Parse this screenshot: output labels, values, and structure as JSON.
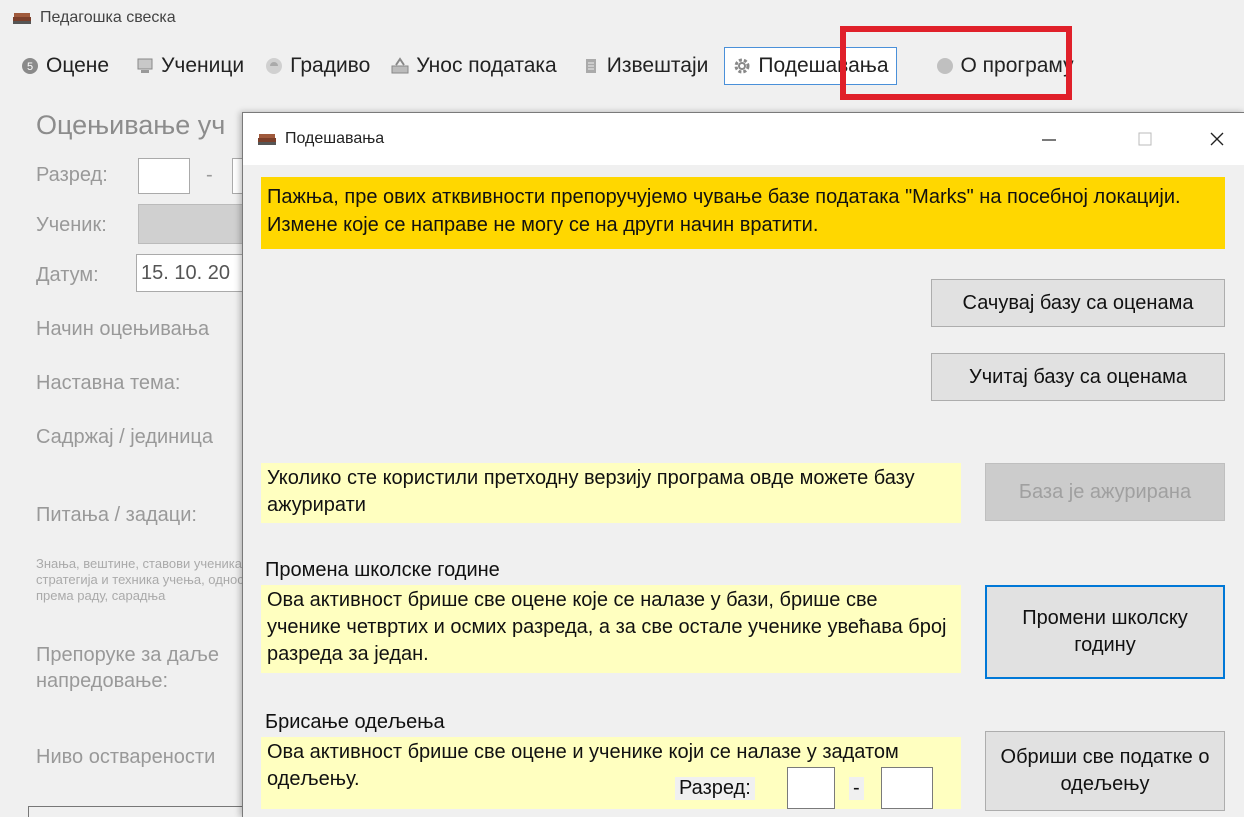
{
  "app": {
    "title": "Педагошка свеска"
  },
  "menu": [
    {
      "label": "Оцене",
      "icon": "grade-icon"
    },
    {
      "label": "Ученици",
      "icon": "students-icon"
    },
    {
      "label": "Градиво",
      "icon": "material-icon"
    },
    {
      "label": "Унос података",
      "icon": "data-entry-icon"
    },
    {
      "label": "Извештаји",
      "icon": "reports-icon"
    },
    {
      "label": "Подешавања",
      "icon": "gear-icon",
      "active": true
    },
    {
      "label": "О програму",
      "icon": "info-icon"
    }
  ],
  "background_form": {
    "heading": "Оцењивање уч",
    "grade_label": "Разред:",
    "grade_sep": "-",
    "student_label": "Ученик:",
    "date_label": "Датум:",
    "date_value": "15. 10. 20",
    "method_label": "Начин оцењивања",
    "topic_label": "Наставна тема:",
    "content_label": "Садржај / јединица",
    "questions_label": "Питања / задаци:",
    "skills_note": "Знања, вештине, ставови ученика, стратегија и техника учења, однос према раду, сарадња",
    "recommend_label": "Препоруке за даље напредовање:",
    "level_label": "Ниво остварености"
  },
  "dialog": {
    "title": "Подешавања",
    "warning": "Пажња, пре ових атквивности препоручујемо чување базе података \"Marks\" на посебној локацији. Измене које се направе не могу се на други начин вратити.",
    "save_db_button": "Сачувај базу са оценама",
    "load_db_button": "Учитај базу са оценама",
    "update_note": "Уколико сте користили претходну верзију програма овде можете базу ажурирати",
    "update_button": "База је ажурирана",
    "school_year_title": "Промена школске године",
    "school_year_note": "Ова активност брише све оцене које се налазе у бази, брише све ученике четвртих и осмих разреда, а за све остале ученике увећава број разреда за један.",
    "school_year_button": "Промени школску годину",
    "delete_class_title": "Брисање одељења",
    "delete_class_note": "Ова активност брише све оцене и ученике који се налазе у задатом одељењу.",
    "grade_label": "Разред:",
    "grade_sep": "-",
    "delete_class_button": "Обриши све податке о одељењу"
  },
  "colors": {
    "warning_bg": "#ffd700",
    "note_bg": "#ffffc0",
    "highlight": "#e0202a",
    "accent": "#0078d7"
  }
}
